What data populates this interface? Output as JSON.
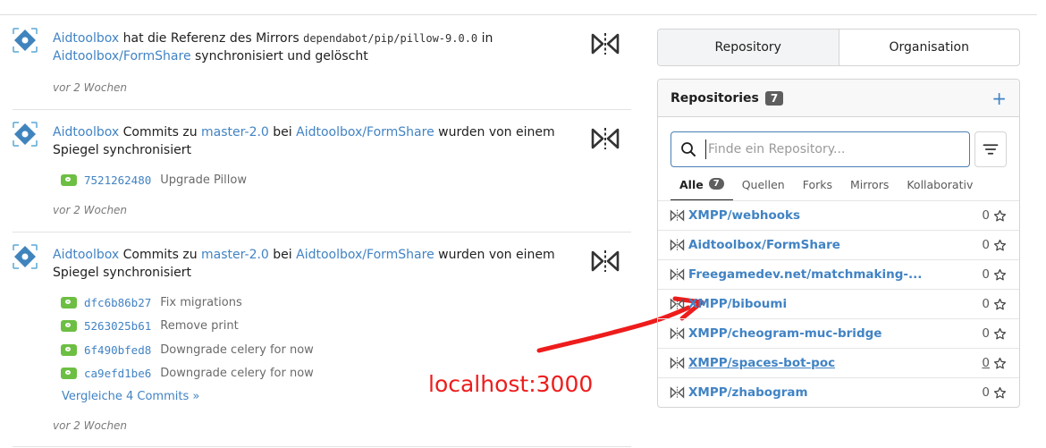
{
  "feed": [
    {
      "user": "Aidtoolbox",
      "text_1": "hat die Referenz des Mirrors",
      "ref": "dependabot/pip/pillow-9.0.0",
      "text_2": "in",
      "repo": "Aidtoolbox/FormShare",
      "text_3": "synchronisiert und gelöscht",
      "time": "vor 2 Wochen"
    },
    {
      "user": "Aidtoolbox",
      "text_1": "Commits zu",
      "branch": "master-2.0",
      "text_2": "bei",
      "repo": "Aidtoolbox/FormShare",
      "text_3": "wurden von einem Spiegel synchronisiert",
      "commits": [
        {
          "sha": "7521262480",
          "message": "Upgrade Pillow"
        }
      ],
      "time": "vor 2 Wochen"
    },
    {
      "user": "Aidtoolbox",
      "text_1": "Commits zu",
      "branch": "master-2.0",
      "text_2": "bei",
      "repo": "Aidtoolbox/FormShare",
      "text_3": "wurden von einem Spiegel synchronisiert",
      "commits": [
        {
          "sha": "dfc6b86b27",
          "message": "Fix migrations"
        },
        {
          "sha": "5263025b61",
          "message": "Remove print"
        },
        {
          "sha": "6f490bfed8",
          "message": "Downgrade celery for now"
        },
        {
          "sha": "ca9efd1be6",
          "message": "Downgrade celery for now"
        }
      ],
      "compare": "Vergleiche 4 Commits »",
      "time": "vor 2 Wochen"
    }
  ],
  "annotation": {
    "text": "localhost:3000",
    "color": "#ee1c1c"
  },
  "tabs": {
    "repository": "Repository",
    "organisation": "Organisation"
  },
  "repos": {
    "title": "Repositories",
    "count": "7",
    "add_icon": "plus-icon",
    "search_placeholder": "Finde ein Repository...",
    "filters": [
      {
        "label": "Alle",
        "count": "7"
      },
      {
        "label": "Quellen"
      },
      {
        "label": "Forks"
      },
      {
        "label": "Mirrors"
      },
      {
        "label": "Kollaborativ"
      }
    ],
    "items": [
      {
        "name": "XMPP/webhooks",
        "stars": "0"
      },
      {
        "name": "Aidtoolbox/FormShare",
        "stars": "0"
      },
      {
        "name": "Freegamedev.net/matchmaking-...",
        "stars": "0"
      },
      {
        "name": "XMPP/biboumi",
        "stars": "0"
      },
      {
        "name": "XMPP/cheogram-muc-bridge",
        "stars": "0"
      },
      {
        "name": "XMPP/spaces-bot-poc",
        "stars": "0"
      },
      {
        "name": "XMPP/zhabogram",
        "stars": "0"
      }
    ]
  },
  "colors": {
    "link": "#4183c4",
    "commit_badge": "#6cbf43",
    "annotation": "#ee1c1c"
  }
}
